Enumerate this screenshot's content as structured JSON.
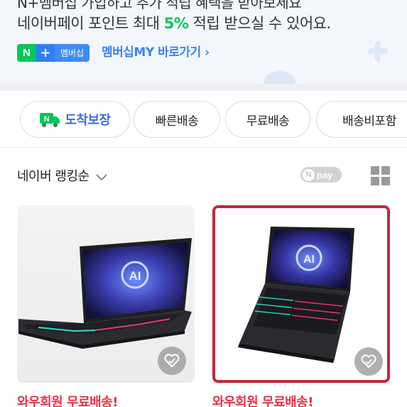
{
  "promo": {
    "cut_line": "N+멤버십 가입하고 추가 적립 혜택을 받아보세요",
    "line_pre": "네이버페이 포인트 최대 ",
    "line_pct": "5%",
    "line_post": " 적립 받으실 수 있어요.",
    "badge_n": "N",
    "badge_plus": "+",
    "badge_label": "멤버십",
    "link_label": "멤버십MY 바로가기",
    "link_arrow": "›"
  },
  "filters": {
    "arrival_label": "도착보장",
    "chips": [
      "빠른배송",
      "무료배송",
      "배송비포함"
    ]
  },
  "ranking": {
    "sort_label": "네이버 랭킹순",
    "npay_label": "pay",
    "npay_knob": "N"
  },
  "products": [
    {
      "shipping_label": "와우회원 무료배송!"
    },
    {
      "shipping_label": "와우회원 무료배송!"
    }
  ],
  "colors": {
    "accent_green": "#03c75a",
    "accent_blue": "#3b82f6",
    "highlight_border": "#c8243e",
    "shipping_red": "#e8334a"
  },
  "icons": {
    "sort": "chevron-down-icon",
    "layout": "grid-view-icon",
    "wishlist": "heart-icon",
    "arrival": "truck-icon"
  }
}
